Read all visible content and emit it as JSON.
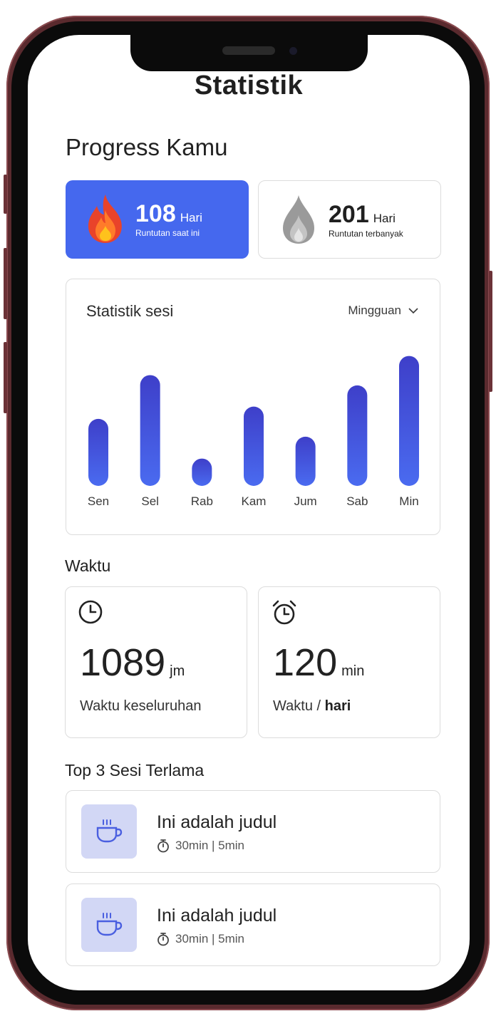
{
  "header": {
    "title": "Statistik"
  },
  "progress": {
    "heading": "Progress Kamu",
    "current_streak": {
      "value": "108",
      "unit": "Hari",
      "label": "Runtutan saat ini",
      "icon": "fire-icon"
    },
    "best_streak": {
      "value": "201",
      "unit": "Hari",
      "label": "Runtutan terbanyak",
      "icon": "drop-icon"
    }
  },
  "session_stats": {
    "title": "Statistik sesi",
    "period": "Mingguan"
  },
  "chart_data": {
    "type": "bar",
    "categories": [
      "Sen",
      "Sel",
      "Rab",
      "Kam",
      "Jum",
      "Sab",
      "Min"
    ],
    "values": [
      98,
      162,
      40,
      116,
      72,
      147,
      190
    ],
    "ylim": [
      0,
      200
    ],
    "grid": false,
    "colors": [
      "#3e3fc9",
      "#4a6bf0"
    ]
  },
  "time": {
    "heading": "Waktu",
    "total": {
      "value": "1089",
      "unit": "jm",
      "label": "Waktu keseluruhan",
      "icon": "clock-icon"
    },
    "per_day": {
      "value": "120",
      "unit": "min",
      "label_prefix": "Waktu /",
      "label_bold": "hari",
      "icon": "alarm-clock-icon"
    }
  },
  "top_sessions": {
    "heading": "Top 3 Sesi Terlama",
    "items": [
      {
        "title": "Ini adalah judul",
        "meta": "30min | 5min",
        "icon": "coffee-cup-icon"
      },
      {
        "title": "Ini adalah judul",
        "meta": "30min | 5min",
        "icon": "coffee-cup-icon"
      }
    ]
  },
  "colors": {
    "accent": "#4568ee",
    "thumb_bg": "#d2d7f5",
    "frame": "#5a2a2e"
  }
}
